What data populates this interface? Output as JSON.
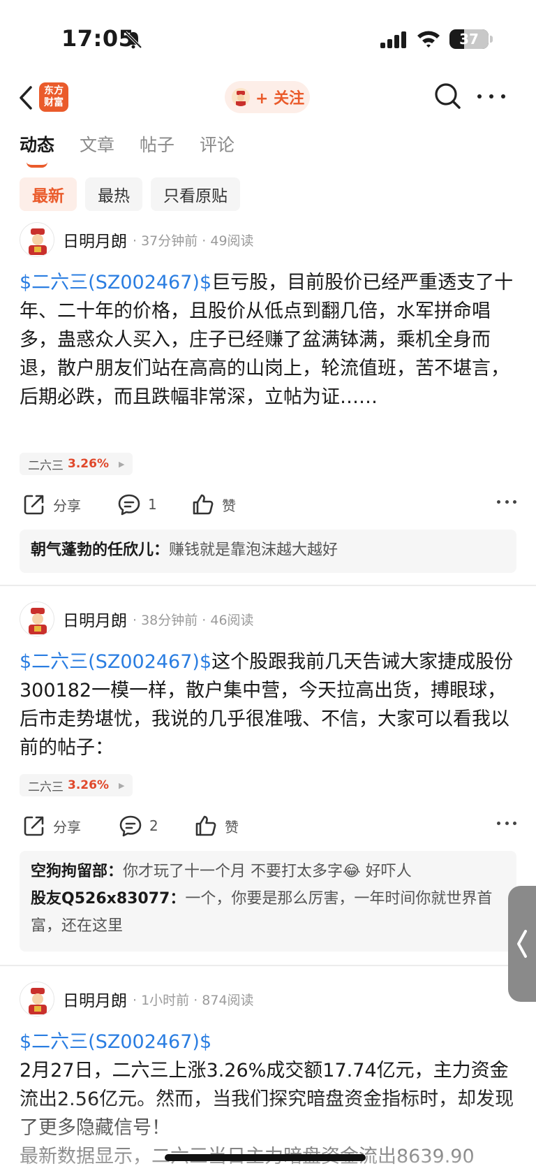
{
  "status_bar": {
    "time": "17:05",
    "battery": "37",
    "battery_level": 0.37
  },
  "header": {
    "logo_text_line1": "东方",
    "logo_text_line2": "财富",
    "follow_label": "+ 关注"
  },
  "tabs": [
    {
      "label": "动态",
      "active": true
    },
    {
      "label": "文章",
      "active": false
    },
    {
      "label": "帖子",
      "active": false
    },
    {
      "label": "评论",
      "active": false
    }
  ],
  "filters": [
    {
      "label": "最新",
      "active": true
    },
    {
      "label": "最热",
      "active": false
    },
    {
      "label": "只看原贴",
      "active": false
    }
  ],
  "posts": [
    {
      "author": "日明月朗",
      "meta": "· 37分钟前 · 49阅读",
      "stock_link": "$二六三(SZ002467)$",
      "text": "巨亏股，目前股价已经严重透支了十年、二十年的价格，且股价从低点到翻几倍，水军拼命唱多，蛊惑众人买入，庄子已经赚了盆满钵满，乘机全身而退，散户朋友们站在高高的山岗上，轮流值班，苦不堪言，后期必跌，而且跌幅非常深，立帖为证……",
      "tag_name": "二六三",
      "tag_pct": "3.26%",
      "share_label": "分享",
      "comment_count": "1",
      "like_label": "赞",
      "comments": [
        {
          "name": "朝气蓬勃的任欣儿",
          "text": "赚钱就是靠泡沫越大越好"
        }
      ]
    },
    {
      "author": "日明月朗",
      "meta": "· 38分钟前 · 46阅读",
      "stock_link": "$二六三(SZ002467)$",
      "text": "这个股跟我前几天告诫大家捷成股份300182一模一样，散户集中营，今天拉高出货，搏眼球，后市走势堪忧，我说的几乎很准哦、不信，大家可以看我以前的帖子：",
      "tag_name": "二六三",
      "tag_pct": "3.26%",
      "share_label": "分享",
      "comment_count": "2",
      "like_label": "赞",
      "comments": [
        {
          "name": "空狗拘留部",
          "text": "你才玩了十一个月 不要打太多字😂 好吓人"
        },
        {
          "name": "股友Q526x83077",
          "text": "一个，你要是那么厉害，一年时间你就世界首富，还在这里"
        }
      ]
    },
    {
      "author": "日明月朗",
      "meta": "· 1小时前 · 874阅读",
      "stock_link": "$二六三(SZ002467)$",
      "line1": "2月27日，二六三上涨3.26%成交额17.74亿元，主力资金流出2.56亿元。然而，当我们探究暗盘资金指标时，却发现了更多隐藏信号！",
      "line2": "最新数据显示，二六三当日主力暗盘资金流出8639.90"
    }
  ]
}
